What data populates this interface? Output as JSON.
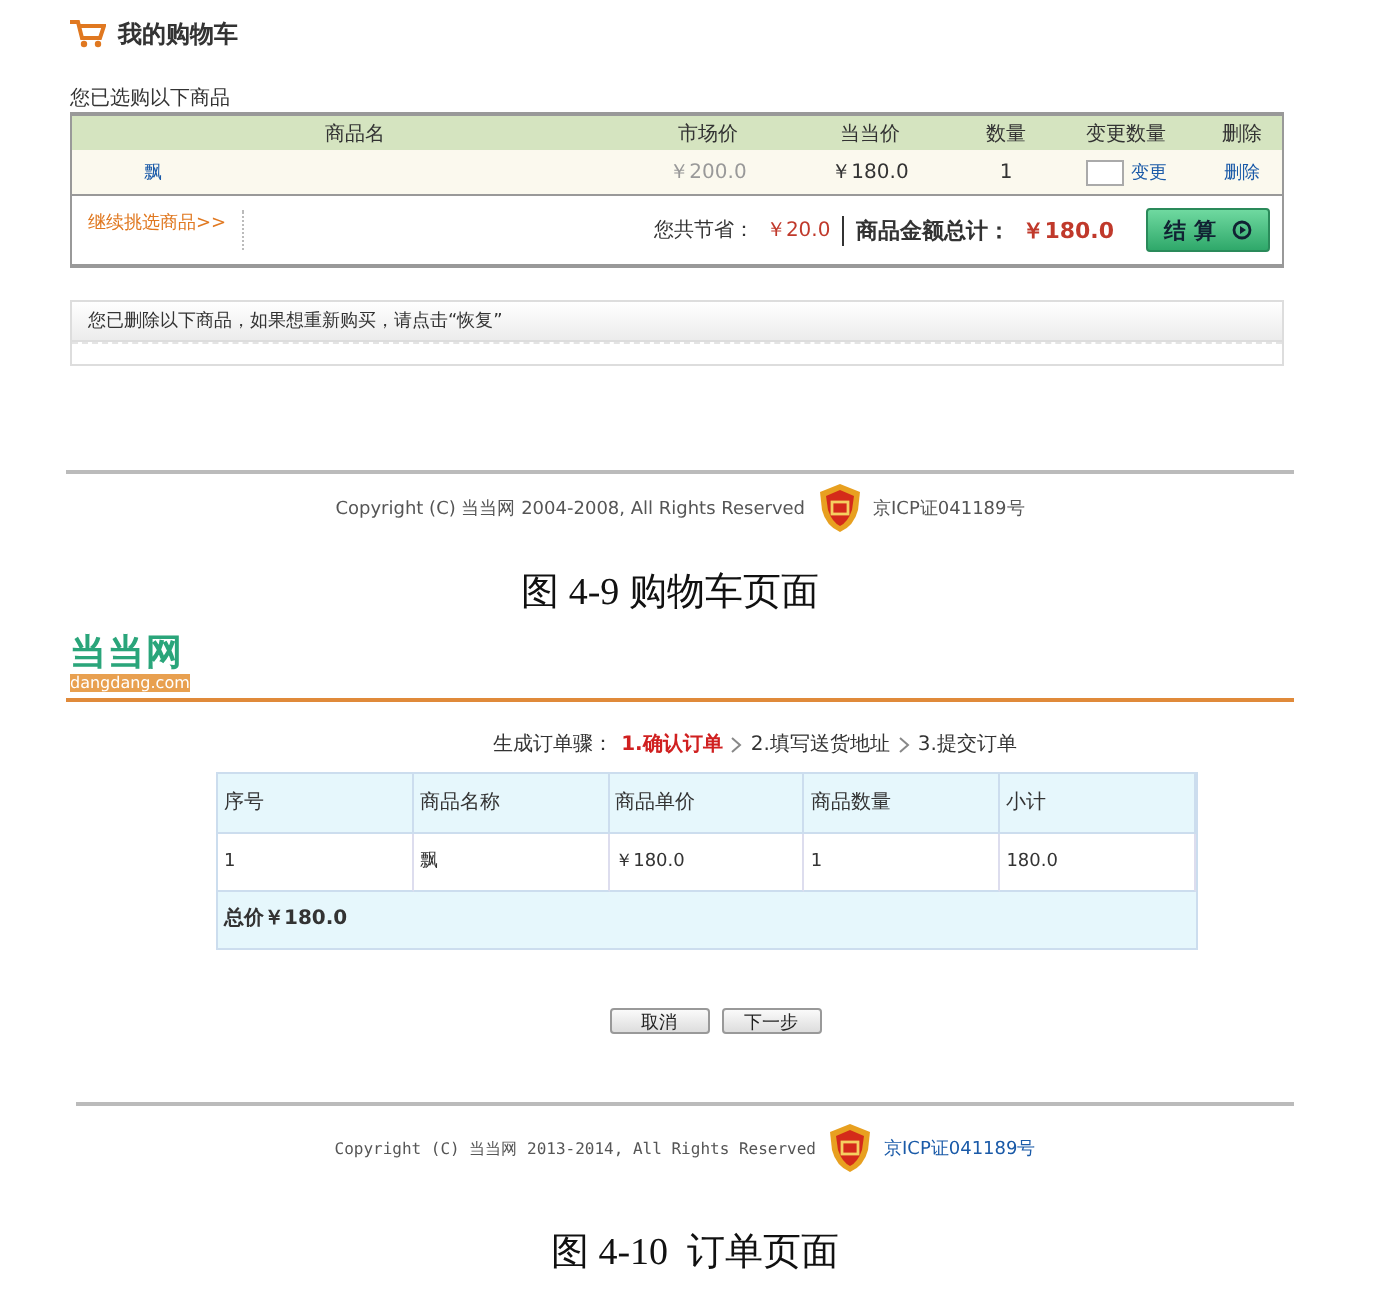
{
  "cart": {
    "title": "我的购物车",
    "intro": "您已选购以下商品",
    "columns": [
      "商品名",
      "市场价",
      "当当价",
      "数量",
      "变更数量",
      "删除"
    ],
    "rows": [
      {
        "name": "飘",
        "market_price": "￥200.0",
        "price": "￥180.0",
        "quantity": "1",
        "change": "变更",
        "delete": "删除"
      }
    ],
    "continue_link": "继续挑选商品>>",
    "savings_label": "您共节省：",
    "savings": "￥20.0",
    "total_label": "商品金额总计：",
    "total": "￥180.0",
    "checkout": "结 算"
  },
  "deleted_notice": "您已删除以下商品，如果想重新购买，请点击“恢复”",
  "footer_1": {
    "copyright": "Copyright (C) 当当网 2004-2008, All Rights Reserved",
    "license": "京ICP证041189号"
  },
  "caption_1": "图 4-9 购物车页面",
  "order": {
    "logo": "当当网",
    "logo_domain": "dangdang.com",
    "steps_label": "生成订单骤：",
    "steps": [
      {
        "label": "1.确认订单",
        "selected": true
      },
      {
        "label": "2.填写送货地址",
        "selected": false
      },
      {
        "label": "3.提交订单",
        "selected": false
      }
    ],
    "columns": [
      "序号",
      "商品名称",
      "商品单价",
      "商品数量",
      "小计"
    ],
    "rows": [
      [
        "1",
        "飘",
        "￥180.0",
        "1",
        "180.0"
      ]
    ],
    "total": "总价￥180.0",
    "buttons": [
      "取消",
      "下一步"
    ]
  },
  "footer_2": {
    "copyright": "Copyright (C) 当当网 2013-2014, All Rights Reserved",
    "license": "京ICP证041189号"
  },
  "caption_2": "图 4-10  订单页面"
}
